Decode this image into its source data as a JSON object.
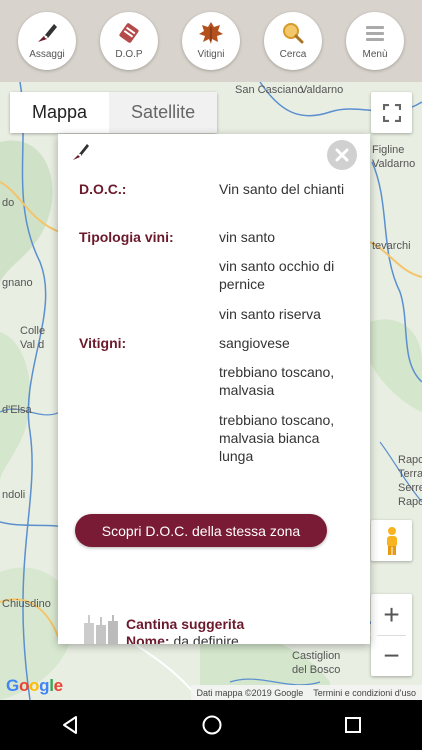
{
  "nav": {
    "items": [
      {
        "label": "Assaggi",
        "icon": "pen-nib-icon"
      },
      {
        "label": "D.O.P",
        "icon": "scroll-icon"
      },
      {
        "label": "Vitigni",
        "icon": "grape-leaf-icon"
      },
      {
        "label": "Cerca",
        "icon": "search-icon"
      },
      {
        "label": "Menù",
        "icon": "menu-icon"
      }
    ]
  },
  "map": {
    "type_map": "Mappa",
    "type_satellite": "Satellite",
    "labels": {
      "casciano": "San Casciano",
      "valdarno": "Valdarno",
      "figline": "Figline",
      "valdarno2": "Valdarno",
      "do": "do",
      "tevarchi": "tevarchi",
      "gnano": "gnano",
      "colle": "Colle",
      "valdel": "Val d",
      "elsa": "d'Elsa",
      "ndoli": "ndoli",
      "rapola": "Rapola",
      "terranuova": "Terran",
      "serre": "Serre",
      "rapolano": "Rapolan",
      "chiusdino": "Chiusdino",
      "castiglion": "Castiglion",
      "delbosco": "del Bosco"
    },
    "footer_data": "Dati mappa ©2019 Google",
    "footer_terms": "Termini e condizioni d'uso",
    "zoom_in": "+",
    "zoom_out": "−"
  },
  "popup": {
    "rows": [
      {
        "key": "D.O.C.:",
        "value": "Vin santo del chianti"
      },
      {
        "key": "Tipologia vini:",
        "value": "vin santo"
      },
      {
        "key": "",
        "value": "vin santo occhio di pernice"
      },
      {
        "key": "",
        "value": "vin santo riserva"
      },
      {
        "key": "Vitigni:",
        "value": "sangiovese"
      },
      {
        "key": "",
        "value": "trebbiano toscano, malvasia"
      },
      {
        "key": "",
        "value": "trebbiano toscano, malvasia bianca lunga"
      }
    ],
    "scopri_label": "Scopri D.O.C. della stessa zona",
    "cantina_title": "Cantina suggerita",
    "cantina_nome_key": "Nome:",
    "cantina_nome_value": " da definire"
  },
  "colors": {
    "accent": "#7a1b35",
    "label": "#6b1a2c"
  }
}
